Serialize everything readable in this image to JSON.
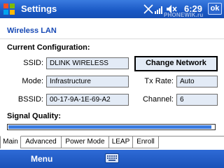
{
  "titlebar": {
    "title": "Settings",
    "time": "6:29",
    "ok_label": "ok",
    "watermark": "PHONEWIK.ru",
    "icons": [
      "start-icon",
      "connectivity-icon",
      "signal-icon",
      "speaker-mute-icon"
    ]
  },
  "page": {
    "title": "Wireless LAN",
    "current_config_heading": "Current Configuration:",
    "signal_heading": "Signal Quality:",
    "signal_quality_fraction": 0.985
  },
  "fields": {
    "ssid_label": "SSID:",
    "ssid_value": "DLINK  WIRELESS",
    "mode_label": "Mode:",
    "mode_value": "Infrastructure",
    "bssid_label": "BSSID:",
    "bssid_value": "00-17-9A-1E-69-A2",
    "tx_rate_label": "Tx Rate:",
    "tx_rate_value": "Auto",
    "channel_label": "Channel:",
    "channel_value": "6"
  },
  "buttons": {
    "change_network": "Change Network"
  },
  "tabs": [
    {
      "label": "Main",
      "active": true
    },
    {
      "label": "Advanced",
      "active": false
    },
    {
      "label": "Power Mode",
      "active": false
    },
    {
      "label": "LEAP",
      "active": false
    },
    {
      "label": "Enroll",
      "active": false
    }
  ],
  "menubar": {
    "left_label": "Menu",
    "keyboard_icon": "keyboard-icon"
  },
  "colors": {
    "titlebar": "#1a58c4",
    "heading": "#1749b5",
    "field_bg": "#e3ebf6",
    "signal_fill": "#3a7be0"
  }
}
